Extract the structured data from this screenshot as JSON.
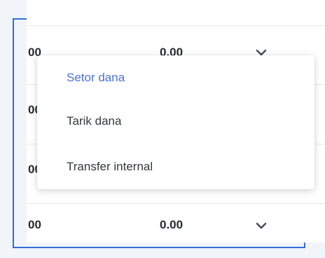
{
  "table": {
    "rows": [
      {
        "col1": "00",
        "col2": "0.00"
      },
      {
        "col1": "00",
        "col2": ""
      },
      {
        "col1": "00",
        "col2": ""
      },
      {
        "col1": "00",
        "col2": "0.00"
      }
    ],
    "expand_icon": "chevron-down-icon"
  },
  "dropdown": {
    "items": [
      {
        "label": "Setor dana",
        "selected": true
      },
      {
        "label": "Tarik dana",
        "selected": false
      },
      {
        "label": "Transfer internal",
        "selected": false
      }
    ]
  },
  "colors": {
    "frame_border": "#2f6fd6",
    "selected_item": "#4a6fdc",
    "text": "#262a33"
  }
}
